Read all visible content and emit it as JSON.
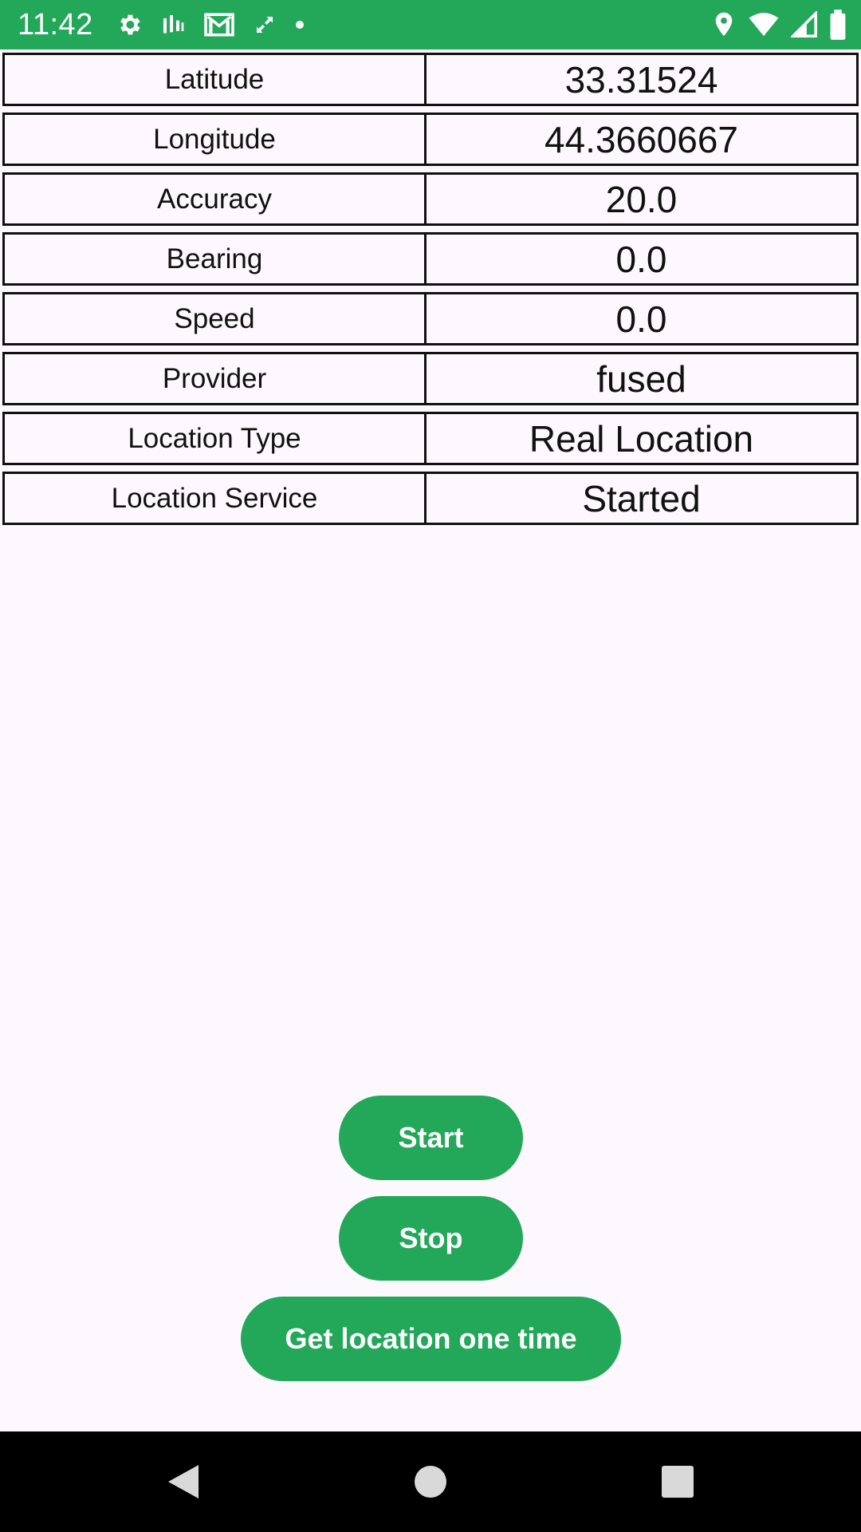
{
  "status_bar": {
    "time": "11:42",
    "left_icons": [
      "settings-icon",
      "signal-bars-icon",
      "gmail-icon",
      "sync-icon",
      "notification-dot-icon"
    ],
    "right_icons": [
      "location-pin-icon",
      "wifi-icon",
      "cellular-signal-icon",
      "battery-icon"
    ]
  },
  "location_table": {
    "rows": [
      {
        "label": "Latitude",
        "value": "33.31524"
      },
      {
        "label": "Longitude",
        "value": "44.3660667"
      },
      {
        "label": "Accuracy",
        "value": "20.0"
      },
      {
        "label": "Bearing",
        "value": "0.0"
      },
      {
        "label": "Speed",
        "value": "0.0"
      },
      {
        "label": "Provider",
        "value": "fused"
      },
      {
        "label": "Location Type",
        "value": "Real Location"
      },
      {
        "label": "Location Service",
        "value": "Started"
      }
    ]
  },
  "buttons": {
    "start": "Start",
    "stop": "Stop",
    "get_once": "Get location one time"
  },
  "nav_bar": {
    "icons": [
      "back-icon",
      "home-icon",
      "recents-icon"
    ]
  },
  "colors": {
    "accent": "#23a85a",
    "background": "#fdf8fd",
    "nav_background": "#000000",
    "border": "#111111"
  }
}
